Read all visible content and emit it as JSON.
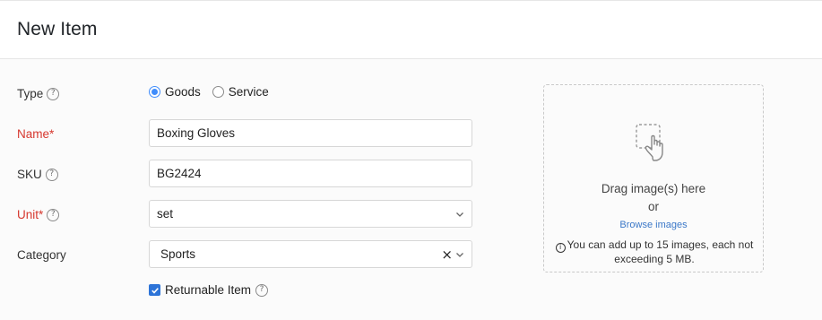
{
  "page": {
    "title": "New Item"
  },
  "form": {
    "type": {
      "label": "Type",
      "help": "?",
      "options": [
        "Goods",
        "Service"
      ],
      "selected": "Goods"
    },
    "name": {
      "label": "Name*",
      "value": "Boxing Gloves"
    },
    "sku": {
      "label": "SKU",
      "help": "?",
      "value": "BG2424"
    },
    "unit": {
      "label": "Unit*",
      "help": "?",
      "value": "set"
    },
    "category": {
      "label": "Category",
      "value": "Sports",
      "clear": "×"
    },
    "returnable": {
      "label": "Returnable Item",
      "checked": true,
      "help": "?"
    }
  },
  "dropzone": {
    "title": "Drag image(s) here",
    "or": "or",
    "browse": "Browse images",
    "note_icon": "i",
    "note": "You can add up to 15 images, each not exceeding 5 MB."
  },
  "colors": {
    "accent": "#408dfb",
    "required": "#d6372e",
    "link": "#3b78c8",
    "checkbox": "#2d74d8"
  },
  "icons": {
    "help": "question-circle-icon",
    "chevron": "chevron-down-icon",
    "dropzone": "drag-hand-icon",
    "info": "info-circle-icon"
  }
}
